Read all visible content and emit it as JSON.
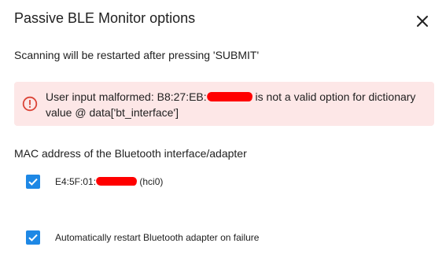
{
  "dialog": {
    "title": "Passive BLE Monitor options",
    "description": "Scanning will be restarted after pressing 'SUBMIT'",
    "close_icon": "close-icon"
  },
  "error": {
    "icon": "error-circle-icon",
    "text_before": "User input malformed: B8:27:EB:",
    "text_after": " is not a valid option for dictionary value @ data['bt_interface']",
    "color": "#db4437",
    "background": "#fde7e7"
  },
  "bt_interface": {
    "label": "MAC address of the Bluetooth interface/adapter",
    "option_prefix": "E4:5F:01:",
    "option_suffix": " (hci0)",
    "checked": true
  },
  "auto_restart": {
    "label": "Automatically restart Bluetooth adapter on failure",
    "checked": true
  },
  "colors": {
    "accent": "#1e88e5",
    "redaction": "#ff0000"
  }
}
